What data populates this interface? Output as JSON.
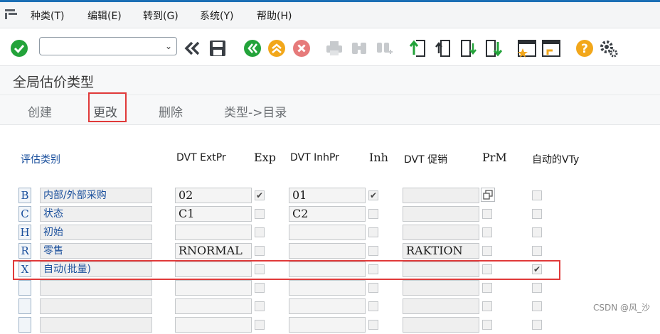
{
  "menu": {
    "items": [
      "种类(T)",
      "编辑(E)",
      "转到(G)",
      "系统(Y)",
      "帮助(H)"
    ]
  },
  "toolbar": {
    "command_value": "",
    "icons": [
      "enter-icon",
      "back-icon",
      "save-icon",
      "back-green-icon",
      "exit-icon",
      "cancel-icon",
      "print-icon",
      "find-icon",
      "find-next-icon",
      "first-page-icon",
      "prev-page-icon",
      "next-page-icon",
      "last-page-icon",
      "new-session-icon",
      "shortcut-icon",
      "help-icon",
      "settings-icon"
    ]
  },
  "title": "全局估价类型",
  "app_toolbar": {
    "create": "创建",
    "change": "更改",
    "delete": "删除",
    "type_to_dir": "类型->目录"
  },
  "table": {
    "headers": {
      "category": "评估类别",
      "dvt_ext": "DVT ExtPr",
      "exp": "Exp",
      "dvt_inh": "DVT InhPr",
      "inh": "Inh",
      "dvt_promo": "DVT 促销",
      "prm": "PrM",
      "auto_vty": "自动的VTy"
    },
    "rows": [
      {
        "key": "B",
        "desc": "内部/外部采购",
        "ext": "02",
        "exp": true,
        "inh_val": "01",
        "inh": true,
        "promo": "",
        "prm": "button",
        "auto": false
      },
      {
        "key": "C",
        "desc": "状态",
        "ext": "C1",
        "exp": false,
        "inh_val": "C2",
        "inh": false,
        "promo": "",
        "prm": false,
        "auto": false
      },
      {
        "key": "H",
        "desc": "初始",
        "ext": "",
        "exp": false,
        "inh_val": "",
        "inh": false,
        "promo": "",
        "prm": false,
        "auto": false
      },
      {
        "key": "R",
        "desc": "零售",
        "ext": "RNORMAL",
        "exp": false,
        "inh_val": "",
        "inh": false,
        "promo": "RAKTION",
        "prm": false,
        "auto": false
      },
      {
        "key": "X",
        "desc": "自动(批量)",
        "ext": "",
        "exp": false,
        "inh_val": "",
        "inh": false,
        "promo": "",
        "prm": false,
        "auto": true
      },
      {
        "key": "",
        "desc": "",
        "ext": "",
        "exp": false,
        "inh_val": "",
        "inh": false,
        "promo": "",
        "prm": false,
        "auto": false
      },
      {
        "key": "",
        "desc": "",
        "ext": "",
        "exp": false,
        "inh_val": "",
        "inh": false,
        "promo": "",
        "prm": false,
        "auto": false
      },
      {
        "key": "",
        "desc": "",
        "ext": "",
        "exp": false,
        "inh_val": "",
        "inh": false,
        "promo": "",
        "prm": false,
        "auto": false
      }
    ]
  },
  "watermark": "CSDN @风_沙",
  "colors": {
    "accent": "#1b6fb5",
    "highlight": "#e03a3a",
    "green": "#23a33a",
    "orange": "#f2a71b",
    "red": "#e14b4b"
  }
}
